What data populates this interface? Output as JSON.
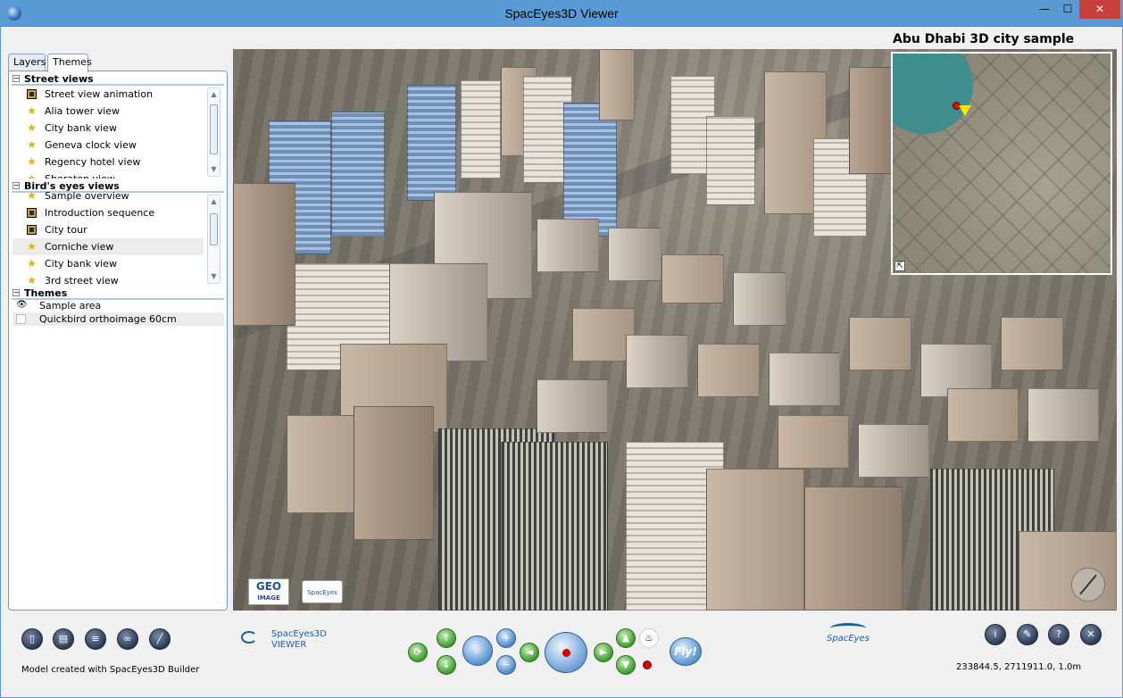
{
  "window": {
    "title": "SpacEyes3D Viewer",
    "min": "—",
    "max": "☐",
    "close": "✕"
  },
  "tabs": [
    {
      "label": "Layers"
    },
    {
      "label": "Themes"
    }
  ],
  "street_views": {
    "header": "Street views",
    "items": [
      {
        "label": "Street view animation",
        "icon": "film-icon"
      },
      {
        "label": "Alia tower view",
        "icon": "star-icon"
      },
      {
        "label": "City bank view",
        "icon": "star-icon"
      },
      {
        "label": "Geneva clock view",
        "icon": "star-icon"
      },
      {
        "label": "Regency hotel view",
        "icon": "star-icon"
      },
      {
        "label": "Sheraton view",
        "icon": "star-icon"
      }
    ]
  },
  "birds_eye_views": {
    "header": "Bird's eyes views",
    "items": [
      {
        "label": "Sample overview",
        "icon": "star-icon"
      },
      {
        "label": "Introduction sequence",
        "icon": "film-icon"
      },
      {
        "label": "City tour",
        "icon": "film-icon"
      },
      {
        "label": "Corniche view",
        "icon": "star-icon"
      },
      {
        "label": "City bank view",
        "icon": "star-icon"
      },
      {
        "label": "3rd street view",
        "icon": "star-icon"
      }
    ]
  },
  "themes": {
    "header": "Themes",
    "items": [
      {
        "label": "Sample area",
        "icon": "eye-icon"
      },
      {
        "label": "Quickbird orthoimage 60cm",
        "icon": "checkbox-empty"
      }
    ]
  },
  "map": {
    "title": "Abu Dhabi 3D city sample",
    "logo_geo": "GEO",
    "logo_geo_sub": "IMAGE",
    "logo_spaceyes": "SpacEyes"
  },
  "toolbar": {
    "fly_label": "Fly!",
    "viewer_logo_line1": "SpacEyes3D",
    "viewer_logo_line2": "VIEWER",
    "brand_logo": "SpacEyes"
  },
  "status": {
    "model_text": "Model created with SpacEyes3D Builder",
    "coordinates": "233844.5, 2711911.0, 1.0m"
  },
  "colors": {
    "titlebar": "#5b9bd5",
    "close": "#c7403a",
    "panel_border": "#6d9cd2"
  }
}
